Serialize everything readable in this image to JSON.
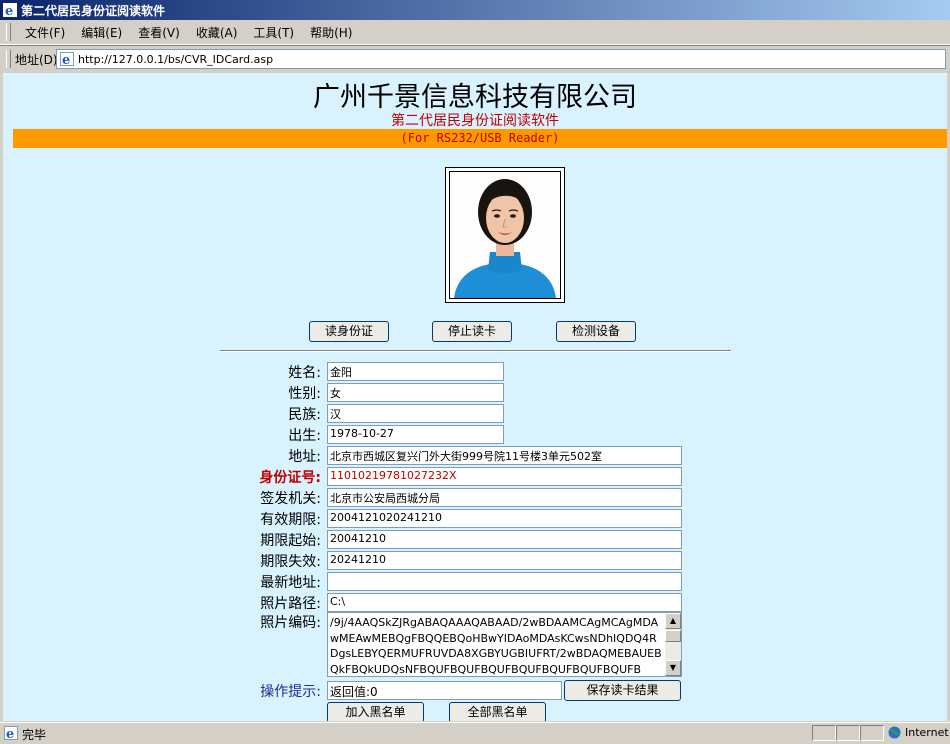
{
  "window": {
    "title": "第二代居民身份证阅读软件"
  },
  "menu": [
    "文件(F)",
    "编辑(E)",
    "查看(V)",
    "收藏(A)",
    "工具(T)",
    "帮助(H)"
  ],
  "address": {
    "label": "地址(D)",
    "url": "http://127.0.0.1/bs/CVR_IDCard.asp"
  },
  "header": {
    "company": "广州千景信息科技有限公司",
    "subtitle": "第二代居民身份证阅读软件",
    "reader": "(For RS232/USB Reader)"
  },
  "buttons": {
    "read": "读身份证",
    "stop": "停止读卡",
    "detect": "检测设备",
    "save": "保存读卡结果",
    "add_blacklist": "加入黑名单",
    "all_blacklist": "全部黑名单"
  },
  "fields": {
    "name": {
      "label": "姓名:",
      "value": "金阳"
    },
    "sex": {
      "label": "性别:",
      "value": "女"
    },
    "nation": {
      "label": "民族:",
      "value": "汉"
    },
    "birth": {
      "label": "出生:",
      "value": "1978-10-27"
    },
    "address": {
      "label": "地址:",
      "value": "北京市西城区复兴门外大街999号院11号楼3单元502室"
    },
    "id_number": {
      "label": "身份证号:",
      "value": "11010219781027232X"
    },
    "issuer": {
      "label": "签发机关:",
      "value": "北京市公安局西城分局"
    },
    "valid": {
      "label": "有效期限:",
      "value": "2004121020241210"
    },
    "start": {
      "label": "期限起始:",
      "value": "20041210"
    },
    "end": {
      "label": "期限失效:",
      "value": "20241210"
    },
    "new_address": {
      "label": "最新地址:",
      "value": ""
    },
    "photo_path": {
      "label": "照片路径:",
      "value": "C:\\"
    },
    "photo_code": {
      "label": "照片编码:",
      "value": "/9j/4AAQSkZJRgABAQAAAQABAAD/2wBDAAMCAgMCAgMDAwMEAwMEBQgFBQQEBQoHBwYIDAoMDAsKCwsNDhIQDQ4RDgsLEBYQERMUFRUVDA8XGBYUGBIUFRT/2wBDAQMEBAUEBQkFBQkUDQsNFBQUFBQUFBQUFBQUFBQUFBQUFBQUFB"
    },
    "hint": {
      "label": "操作提示:",
      "value": "返回值:0"
    }
  },
  "status": {
    "text": "完毕",
    "zone": "Internet"
  },
  "colors": {
    "content_bg": "#d9f3fe",
    "orange_bar": "#ff9900",
    "red_text": "#c00000",
    "hint_label": "#1a2e8f"
  },
  "icons": {
    "ie": "ie-logo-icon",
    "globe": "globe-icon"
  }
}
